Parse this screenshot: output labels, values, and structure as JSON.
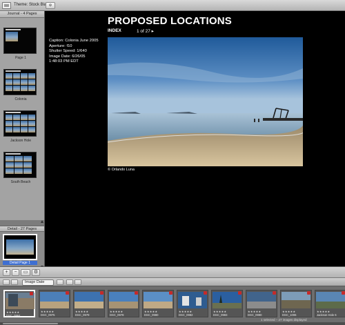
{
  "toolbar": {
    "theme_label": "Theme: Stock Black"
  },
  "journal": {
    "header": "Journal - 4 Pages",
    "pages": [
      {
        "label": "Page 1"
      },
      {
        "label": "Colonia"
      },
      {
        "label": "Jackson Hole"
      },
      {
        "label": "South Beach"
      }
    ]
  },
  "detail": {
    "header": "Detail - 27 Pages",
    "selected_label": "Detail Page 1"
  },
  "page": {
    "title": "PROPOSED LOCATIONS",
    "index_label": "INDEX",
    "pager": "1 of 27 ▸",
    "metadata": [
      "Caption: Colonia June 2005",
      "Aperture: f10",
      "Shutter Speed: 1/640",
      "Image Date: 6/26/05",
      "1:48:03 PM EDT"
    ],
    "credit": "© Orlando Luna"
  },
  "browser": {
    "sort_value": "Image Date"
  },
  "filmstrip": {
    "items": [
      {
        "name": "DSC_0964",
        "stars": "★★★★★"
      },
      {
        "name": "DSC_0975",
        "stars": "★★★★★"
      },
      {
        "name": "DSC_0979",
        "stars": "★★★★★"
      },
      {
        "name": "DSC_0978",
        "stars": "★★★★★"
      },
      {
        "name": "DSC_0980",
        "stars": "★★★★★"
      },
      {
        "name": "DSC_0982",
        "stars": "★★★★★"
      },
      {
        "name": "DSC_0983",
        "stars": "★★★★★"
      },
      {
        "name": "DSC_0990",
        "stars": "★★★★★"
      },
      {
        "name": "DSC_1006",
        "stars": "★★★★★"
      },
      {
        "name": "Jackson Hole 6",
        "stars": "★★★★★"
      }
    ],
    "status": "1 selected – 27 images displayed"
  },
  "colors": {
    "selection_blue": "#3e6fd2",
    "badge_red": "#c52a2a",
    "page_bg": "#000000"
  }
}
